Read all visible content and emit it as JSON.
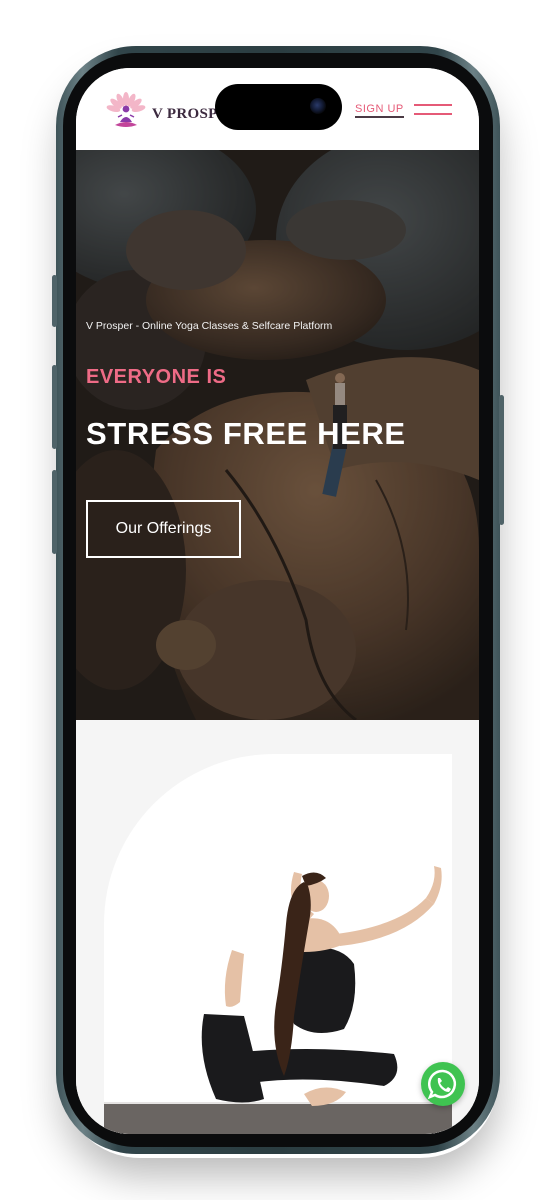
{
  "header": {
    "brand": "V PROSPER",
    "signup_label": "SIGN UP"
  },
  "hero": {
    "tagline": "V Prosper - Online Yoga Classes & Selfcare Platform",
    "kicker": "EVERYONE IS",
    "title": "STRESS FREE HERE",
    "cta_label": "Our Offerings"
  },
  "icons": {
    "logo": "lotus-meditation-logo",
    "menu": "hamburger-menu-icon",
    "chat": "whatsapp-icon"
  },
  "colors": {
    "accent": "#e55a77",
    "whatsapp": "#3fc351",
    "frame": "#2f4247"
  }
}
